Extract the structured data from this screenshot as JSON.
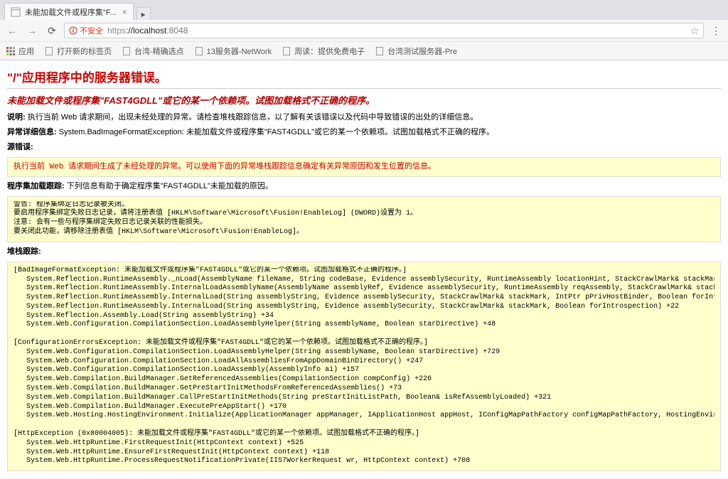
{
  "browser": {
    "tab": {
      "title": "未能加载文件或程序集\"F...",
      "close": "×"
    },
    "nav": {
      "back": "←",
      "forward": "→",
      "reload": "⟳"
    },
    "insecure_label": "不安全",
    "url": {
      "scheme": "https",
      "host": "://localhost",
      "port": ":8048"
    },
    "bookmarks": {
      "apps_label": "应用",
      "items": [
        {
          "label": "打开新的标签页"
        },
        {
          "label": "台湾-精确选点"
        },
        {
          "label": "13服务器-NetWork"
        },
        {
          "label": "周读：提供免费电子"
        },
        {
          "label": "台湾测试服务器-Pre"
        }
      ]
    }
  },
  "error": {
    "h1": "\"/\"应用程序中的服务器错误。",
    "h2": "未能加载文件或程序集\"FAST4GDLL\"或它的某一个依赖项。试图加载格式不正确的程序。",
    "desc_label": "说明:",
    "desc_text": " 执行当前 Web 请求期间，出现未经处理的异常。请检查堆栈跟踪信息，以了解有关该错误以及代码中导致错误的出处的详细信息。",
    "exc_label": "异常详细信息:",
    "exc_text": " System.BadImageFormatException: 未能加载文件或程序集\"FAST4GDLL\"或它的某一个依赖项。试图加载格式不正确的程序。",
    "src_label": "源错误:",
    "src_box": "执行当前 Web 请求期间生成了未经处理的异常。可以使用下面的异常堆栈跟踪信息确定有关异常原因和发生位置的信息。",
    "asm_trace_label": "程序集加载跟踪:",
    "asm_trace_text": " 下列信息有助于确定程序集\"FAST4GDLL\"未能加载的原因。",
    "bind_log": "警告: 程序集绑定日志记录被关闭。\n要启用程序集绑定失败日志记录，请将注册表值 [HKLM\\Software\\Microsoft\\Fusion!EnableLog] (DWORD)设置为 1。\n注意: 会有一些与程序集绑定失败日志记录关联的性能损失。\n要关闭此功能，请移除注册表值 [HKLM\\Software\\Microsoft\\Fusion!EnableLog]。",
    "stack_label": "堆栈跟踪:",
    "stack": "[BadImageFormatException: 未能加载文件或程序集\"FAST4GDLL\"或它的某一个依赖项。试图加载格式不正确的程序。]\n   System.Reflection.RuntimeAssembly._nLoad(AssemblyName fileName, String codeBase, Evidence assemblySecurity, RuntimeAssembly locationHint, StackCrawlMark& stackMark, IntPtr pPrivHo\n   System.Reflection.RuntimeAssembly.InternalLoadAssemblyName(AssemblyName assemblyRef, Evidence assemblySecurity, RuntimeAssembly reqAssembly, StackCrawlMark& stackMark, IntPtr pPri\n   System.Reflection.RuntimeAssembly.InternalLoad(String assemblyString, Evidence assemblySecurity, StackCrawlMark& stackMark, IntPtr pPrivHostBinder, Boolean forIntrospection) +110\n   System.Reflection.RuntimeAssembly.InternalLoad(String assemblyString, Evidence assemblySecurity, StackCrawlMark& stackMark, Boolean forIntrospection) +22\n   System.Reflection.Assembly.Load(String assemblyString) +34\n   System.Web.Configuration.CompilationSection.LoadAssemblyHelper(String assemblyName, Boolean starDirective) +48\n\n[ConfigurationErrorsException: 未能加载文件或程序集\"FAST4GDLL\"或它的某一个依赖项。试图加载格式不正确的程序。]\n   System.Web.Configuration.CompilationSection.LoadAssemblyHelper(String assemblyName, Boolean starDirective) +729\n   System.Web.Configuration.CompilationSection.LoadAllAssembliesFromAppDomainBinDirectory() +247\n   System.Web.Configuration.CompilationSection.LoadAssembly(AssemblyInfo ai) +157\n   System.Web.Compilation.BuildManager.GetReferencedAssemblies(CompilationSection compConfig) +226\n   System.Web.Compilation.BuildManager.GetPreStartInitMethodsFromReferencedAssemblies() +73\n   System.Web.Compilation.BuildManager.CallPreStartInitMethods(String preStartInitListPath, Boolean& isRefAssemblyLoaded) +321\n   System.Web.Compilation.BuildManager.ExecutePreAppStart() +170\n   System.Web.Hosting.HostingEnvironment.Initialize(ApplicationManager appManager, IApplicationHost appHost, IConfigMapPathFactory configMapPathFactory, HostingEnvironmentParameters\n\n[HttpException (0x80004005): 未能加载文件或程序集\"FAST4GDLL\"或它的某一个依赖项。试图加载格式不正确的程序。]\n   System.Web.HttpRuntime.FirstRequestInit(HttpContext context) +525\n   System.Web.HttpRuntime.EnsureFirstRequestInit(HttpContext context) +118\n   System.Web.HttpRuntime.ProcessRequestNotificationPrivate(IIS7WorkerRequest wr, HttpContext context) +708"
  }
}
